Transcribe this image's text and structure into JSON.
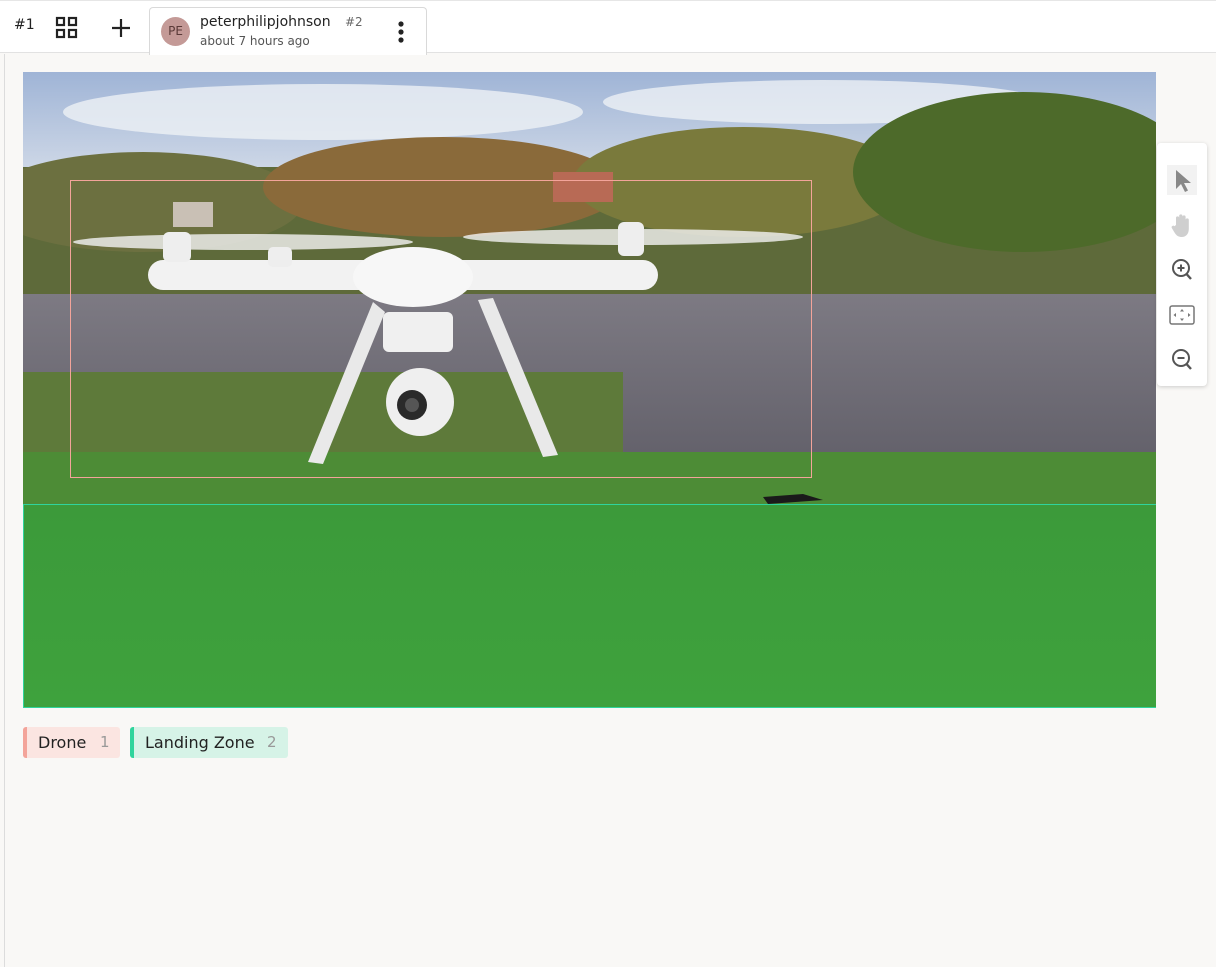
{
  "topbar": {
    "annotation_id": "#1",
    "grid_icon": "grid-icon",
    "add_icon": "plus-icon",
    "tab": {
      "avatar_initials": "PE",
      "username": "peterphilipjohnson",
      "annotation_number": "#2",
      "time_ago": "about 7 hours ago",
      "menu_icon": "more-vertical-icon"
    }
  },
  "canvas": {
    "image_description_icon": "photo",
    "regions": [
      {
        "label": "Drone",
        "color": "#f3a49a"
      },
      {
        "label": "Landing Zone",
        "color": "#2fd49c"
      }
    ]
  },
  "toolbar": {
    "tools": [
      "select-icon",
      "pan-icon",
      "zoom-in-icon",
      "fit-icon",
      "zoom-out-icon"
    ]
  },
  "labels": [
    {
      "name": "Drone",
      "hotkey": "1",
      "color": "#f3a49a",
      "bg": "#fbe5e1"
    },
    {
      "name": "Landing Zone",
      "hotkey": "2",
      "color": "#2fd49c",
      "bg": "#d6f3e7"
    }
  ]
}
